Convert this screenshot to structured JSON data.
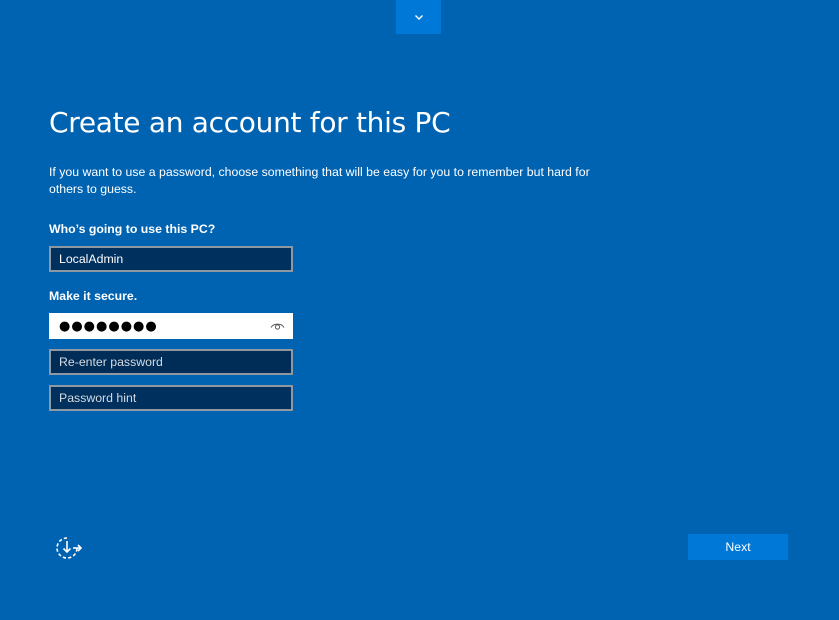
{
  "page": {
    "title": "Create an account for this PC",
    "description": "If you want to use a password, choose something that will be easy for you to remember but hard for others to guess."
  },
  "user": {
    "label": "Who’s going to use this PC?",
    "value": "LocalAdmin"
  },
  "secure": {
    "label": "Make it secure.",
    "password_masked": "●●●●●●●●",
    "reenter_placeholder": "Re-enter password",
    "hint_placeholder": "Password hint"
  },
  "buttons": {
    "next_label": "Next"
  },
  "icons": {
    "top_toggle": "chevron-down-icon",
    "reveal": "eye-icon",
    "ease_of_access": "ease-of-access-icon"
  },
  "colors": {
    "background": "#0063b1",
    "accent": "#0078d7",
    "field_dark": "#00305e"
  }
}
